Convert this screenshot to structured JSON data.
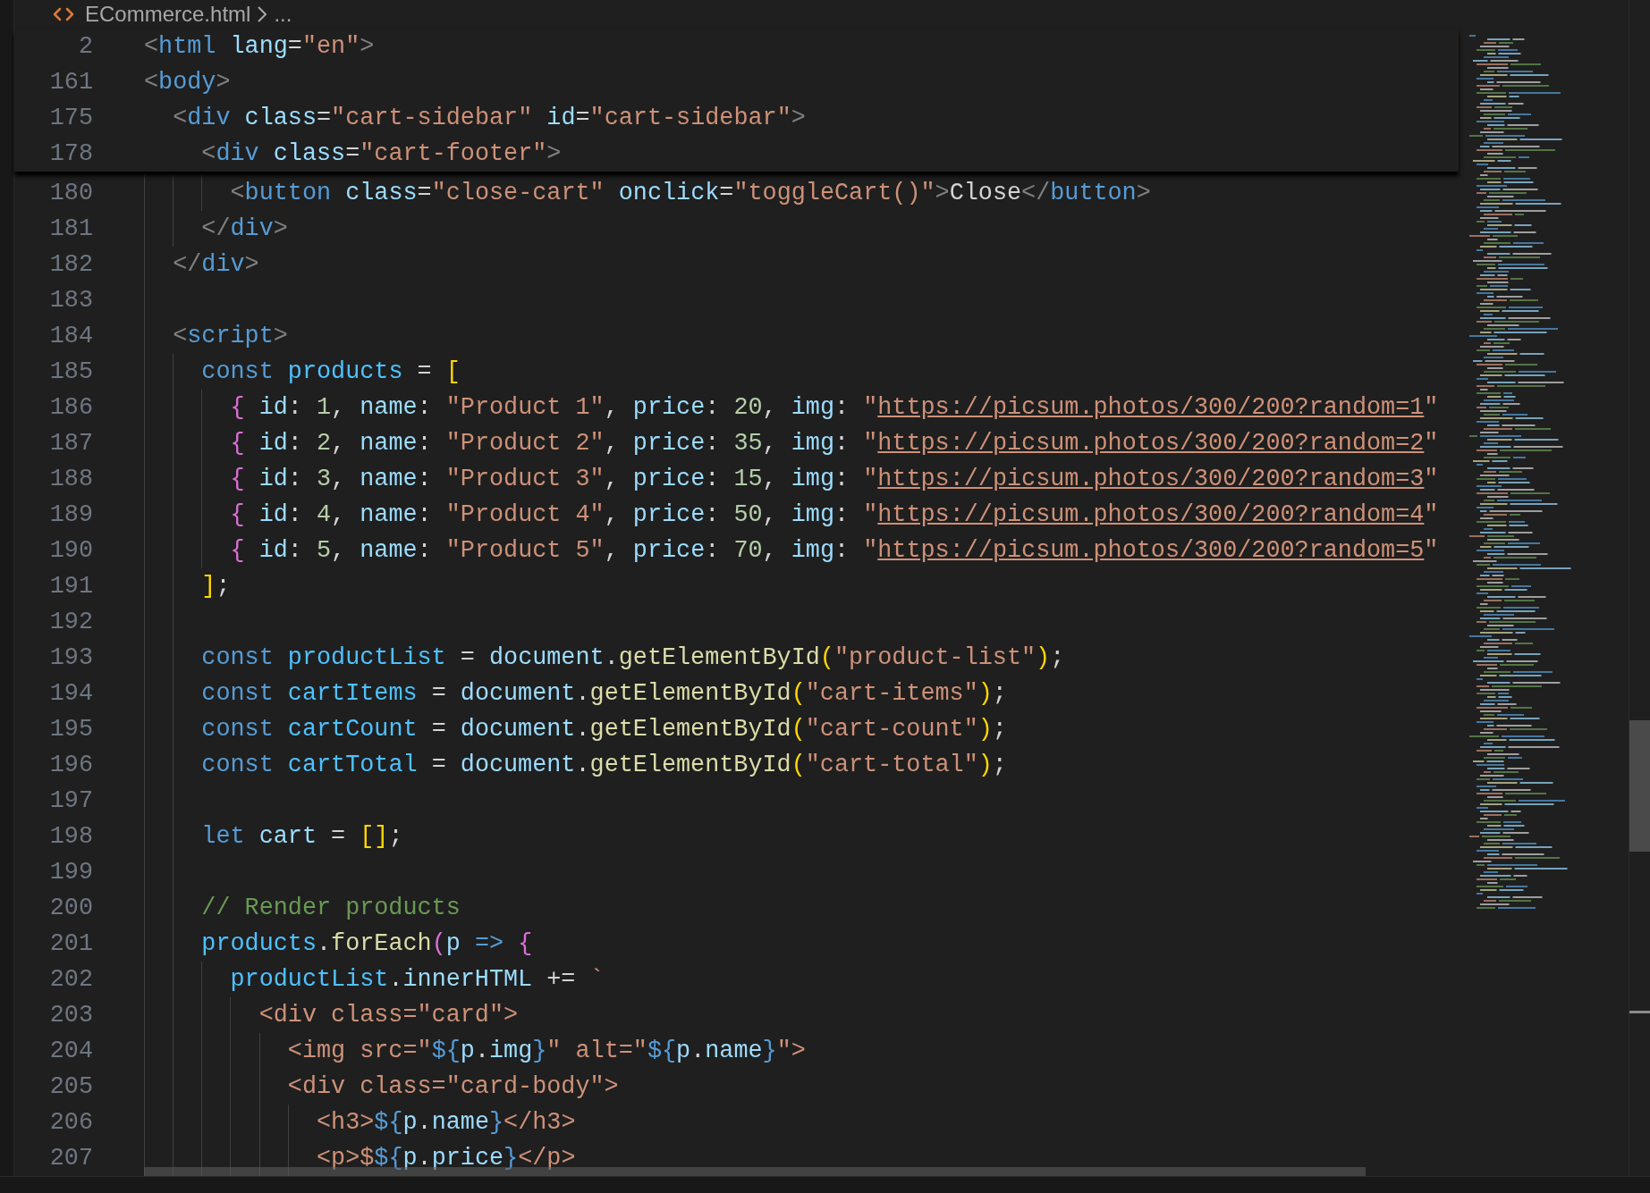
{
  "breadcrumb": {
    "file": "ECommerce.html",
    "rest": "..."
  },
  "sticky_scroll": [
    {
      "number": "2",
      "tokens": [
        {
          "kind": "punct",
          "text": "<"
        },
        {
          "kind": "tag",
          "text": "html"
        },
        {
          "kind": "attr",
          "text": " lang"
        },
        {
          "kind": "text",
          "text": "="
        },
        {
          "kind": "string",
          "text": "\"en\""
        },
        {
          "kind": "punct",
          "text": ">"
        }
      ]
    },
    {
      "number": "161",
      "tokens": [
        {
          "kind": "punct",
          "text": "<"
        },
        {
          "kind": "tag",
          "text": "body"
        },
        {
          "kind": "punct",
          "text": ">"
        }
      ]
    },
    {
      "number": "175",
      "tokens": [
        {
          "kind": "punct",
          "text": "  <"
        },
        {
          "kind": "tag",
          "text": "div"
        },
        {
          "kind": "attr",
          "text": " class"
        },
        {
          "kind": "text",
          "text": "="
        },
        {
          "kind": "string",
          "text": "\"cart-sidebar\""
        },
        {
          "kind": "attr",
          "text": " id"
        },
        {
          "kind": "text",
          "text": "="
        },
        {
          "kind": "string",
          "text": "\"cart-sidebar\""
        },
        {
          "kind": "punct",
          "text": ">"
        }
      ]
    },
    {
      "number": "178",
      "tokens": [
        {
          "kind": "punct",
          "text": "    <"
        },
        {
          "kind": "tag",
          "text": "div"
        },
        {
          "kind": "attr",
          "text": " class"
        },
        {
          "kind": "text",
          "text": "="
        },
        {
          "kind": "string",
          "text": "\"cart-footer\""
        },
        {
          "kind": "punct",
          "text": ">"
        }
      ]
    }
  ],
  "lines": [
    {
      "number": "180",
      "tokens": [
        {
          "kind": "punct",
          "text": "      <"
        },
        {
          "kind": "tag",
          "text": "button"
        },
        {
          "kind": "attr",
          "text": " class"
        },
        {
          "kind": "text",
          "text": "="
        },
        {
          "kind": "string",
          "text": "\"close-cart\""
        },
        {
          "kind": "attr",
          "text": " onclick"
        },
        {
          "kind": "text",
          "text": "="
        },
        {
          "kind": "string",
          "text": "\"toggleCart()\""
        },
        {
          "kind": "punct",
          "text": ">"
        },
        {
          "kind": "text",
          "text": "Close"
        },
        {
          "kind": "punct",
          "text": "</"
        },
        {
          "kind": "tag",
          "text": "button"
        },
        {
          "kind": "punct",
          "text": ">"
        }
      ]
    },
    {
      "number": "181",
      "tokens": [
        {
          "kind": "punct",
          "text": "    </"
        },
        {
          "kind": "tag",
          "text": "div"
        },
        {
          "kind": "punct",
          "text": ">"
        }
      ]
    },
    {
      "number": "182",
      "tokens": [
        {
          "kind": "punct",
          "text": "  </"
        },
        {
          "kind": "tag",
          "text": "div"
        },
        {
          "kind": "punct",
          "text": ">"
        }
      ]
    },
    {
      "number": "183"
    },
    {
      "number": "184",
      "tokens": [
        {
          "kind": "punct",
          "text": "  <"
        },
        {
          "kind": "tag",
          "text": "script"
        },
        {
          "kind": "punct",
          "text": ">"
        }
      ]
    },
    {
      "number": "185",
      "tokens": [
        {
          "kind": "keyword",
          "text": "    const"
        },
        {
          "kind": "const",
          "text": " products"
        },
        {
          "kind": "text",
          "text": " = "
        },
        {
          "kind": "bracket1",
          "text": "["
        }
      ]
    },
    {
      "number": "186",
      "tokens": [
        {
          "kind": "bracket2",
          "text": "      {"
        },
        {
          "kind": "var",
          "text": " id"
        },
        {
          "kind": "text",
          "text": ": "
        },
        {
          "kind": "number",
          "text": "1"
        },
        {
          "kind": "text",
          "text": ", "
        },
        {
          "kind": "var",
          "text": "name"
        },
        {
          "kind": "text",
          "text": ": "
        },
        {
          "kind": "string",
          "text": "\"Product 1\""
        },
        {
          "kind": "text",
          "text": ", "
        },
        {
          "kind": "var",
          "text": "price"
        },
        {
          "kind": "text",
          "text": ": "
        },
        {
          "kind": "number",
          "text": "20"
        },
        {
          "kind": "text",
          "text": ", "
        },
        {
          "kind": "var",
          "text": "img"
        },
        {
          "kind": "text",
          "text": ": "
        },
        {
          "kind": "string",
          "text": "\""
        },
        {
          "kind": "link",
          "text": "https://picsum.photos/300/200?random=1"
        },
        {
          "kind": "string",
          "text": "\""
        }
      ]
    },
    {
      "number": "187",
      "tokens": [
        {
          "kind": "bracket2",
          "text": "      {"
        },
        {
          "kind": "var",
          "text": " id"
        },
        {
          "kind": "text",
          "text": ": "
        },
        {
          "kind": "number",
          "text": "2"
        },
        {
          "kind": "text",
          "text": ", "
        },
        {
          "kind": "var",
          "text": "name"
        },
        {
          "kind": "text",
          "text": ": "
        },
        {
          "kind": "string",
          "text": "\"Product 2\""
        },
        {
          "kind": "text",
          "text": ", "
        },
        {
          "kind": "var",
          "text": "price"
        },
        {
          "kind": "text",
          "text": ": "
        },
        {
          "kind": "number",
          "text": "35"
        },
        {
          "kind": "text",
          "text": ", "
        },
        {
          "kind": "var",
          "text": "img"
        },
        {
          "kind": "text",
          "text": ": "
        },
        {
          "kind": "string",
          "text": "\""
        },
        {
          "kind": "link",
          "text": "https://picsum.photos/300/200?random=2"
        },
        {
          "kind": "string",
          "text": "\""
        }
      ]
    },
    {
      "number": "188",
      "tokens": [
        {
          "kind": "bracket2",
          "text": "      {"
        },
        {
          "kind": "var",
          "text": " id"
        },
        {
          "kind": "text",
          "text": ": "
        },
        {
          "kind": "number",
          "text": "3"
        },
        {
          "kind": "text",
          "text": ", "
        },
        {
          "kind": "var",
          "text": "name"
        },
        {
          "kind": "text",
          "text": ": "
        },
        {
          "kind": "string",
          "text": "\"Product 3\""
        },
        {
          "kind": "text",
          "text": ", "
        },
        {
          "kind": "var",
          "text": "price"
        },
        {
          "kind": "text",
          "text": ": "
        },
        {
          "kind": "number",
          "text": "15"
        },
        {
          "kind": "text",
          "text": ", "
        },
        {
          "kind": "var",
          "text": "img"
        },
        {
          "kind": "text",
          "text": ": "
        },
        {
          "kind": "string",
          "text": "\""
        },
        {
          "kind": "link",
          "text": "https://picsum.photos/300/200?random=3"
        },
        {
          "kind": "string",
          "text": "\""
        }
      ]
    },
    {
      "number": "189",
      "tokens": [
        {
          "kind": "bracket2",
          "text": "      {"
        },
        {
          "kind": "var",
          "text": " id"
        },
        {
          "kind": "text",
          "text": ": "
        },
        {
          "kind": "number",
          "text": "4"
        },
        {
          "kind": "text",
          "text": ", "
        },
        {
          "kind": "var",
          "text": "name"
        },
        {
          "kind": "text",
          "text": ": "
        },
        {
          "kind": "string",
          "text": "\"Product 4\""
        },
        {
          "kind": "text",
          "text": ", "
        },
        {
          "kind": "var",
          "text": "price"
        },
        {
          "kind": "text",
          "text": ": "
        },
        {
          "kind": "number",
          "text": "50"
        },
        {
          "kind": "text",
          "text": ", "
        },
        {
          "kind": "var",
          "text": "img"
        },
        {
          "kind": "text",
          "text": ": "
        },
        {
          "kind": "string",
          "text": "\""
        },
        {
          "kind": "link",
          "text": "https://picsum.photos/300/200?random=4"
        },
        {
          "kind": "string",
          "text": "\""
        }
      ]
    },
    {
      "number": "190",
      "tokens": [
        {
          "kind": "bracket2",
          "text": "      {"
        },
        {
          "kind": "var",
          "text": " id"
        },
        {
          "kind": "text",
          "text": ": "
        },
        {
          "kind": "number",
          "text": "5"
        },
        {
          "kind": "text",
          "text": ", "
        },
        {
          "kind": "var",
          "text": "name"
        },
        {
          "kind": "text",
          "text": ": "
        },
        {
          "kind": "string",
          "text": "\"Product 5\""
        },
        {
          "kind": "text",
          "text": ", "
        },
        {
          "kind": "var",
          "text": "price"
        },
        {
          "kind": "text",
          "text": ": "
        },
        {
          "kind": "number",
          "text": "70"
        },
        {
          "kind": "text",
          "text": ", "
        },
        {
          "kind": "var",
          "text": "img"
        },
        {
          "kind": "text",
          "text": ": "
        },
        {
          "kind": "string",
          "text": "\""
        },
        {
          "kind": "link",
          "text": "https://picsum.photos/300/200?random=5"
        },
        {
          "kind": "string",
          "text": "\""
        }
      ]
    },
    {
      "number": "191",
      "tokens": [
        {
          "kind": "bracket1",
          "text": "    ]"
        },
        {
          "kind": "text",
          "text": ";"
        }
      ]
    },
    {
      "number": "192"
    },
    {
      "number": "193",
      "tokens": [
        {
          "kind": "keyword",
          "text": "    const"
        },
        {
          "kind": "const",
          "text": " productList"
        },
        {
          "kind": "text",
          "text": " = "
        },
        {
          "kind": "var",
          "text": "document"
        },
        {
          "kind": "text",
          "text": "."
        },
        {
          "kind": "func",
          "text": "getElementById"
        },
        {
          "kind": "bracket1",
          "text": "("
        },
        {
          "kind": "string",
          "text": "\"product-list\""
        },
        {
          "kind": "bracket1",
          "text": ")"
        },
        {
          "kind": "text",
          "text": ";"
        }
      ]
    },
    {
      "number": "194",
      "tokens": [
        {
          "kind": "keyword",
          "text": "    const"
        },
        {
          "kind": "const",
          "text": " cartItems"
        },
        {
          "kind": "text",
          "text": " = "
        },
        {
          "kind": "var",
          "text": "document"
        },
        {
          "kind": "text",
          "text": "."
        },
        {
          "kind": "func",
          "text": "getElementById"
        },
        {
          "kind": "bracket1",
          "text": "("
        },
        {
          "kind": "string",
          "text": "\"cart-items\""
        },
        {
          "kind": "bracket1",
          "text": ")"
        },
        {
          "kind": "text",
          "text": ";"
        }
      ]
    },
    {
      "number": "195",
      "tokens": [
        {
          "kind": "keyword",
          "text": "    const"
        },
        {
          "kind": "const",
          "text": " cartCount"
        },
        {
          "kind": "text",
          "text": " = "
        },
        {
          "kind": "var",
          "text": "document"
        },
        {
          "kind": "text",
          "text": "."
        },
        {
          "kind": "func",
          "text": "getElementById"
        },
        {
          "kind": "bracket1",
          "text": "("
        },
        {
          "kind": "string",
          "text": "\"cart-count\""
        },
        {
          "kind": "bracket1",
          "text": ")"
        },
        {
          "kind": "text",
          "text": ";"
        }
      ]
    },
    {
      "number": "196",
      "tokens": [
        {
          "kind": "keyword",
          "text": "    const"
        },
        {
          "kind": "const",
          "text": " cartTotal"
        },
        {
          "kind": "text",
          "text": " = "
        },
        {
          "kind": "var",
          "text": "document"
        },
        {
          "kind": "text",
          "text": "."
        },
        {
          "kind": "func",
          "text": "getElementById"
        },
        {
          "kind": "bracket1",
          "text": "("
        },
        {
          "kind": "string",
          "text": "\"cart-total\""
        },
        {
          "kind": "bracket1",
          "text": ")"
        },
        {
          "kind": "text",
          "text": ";"
        }
      ]
    },
    {
      "number": "197"
    },
    {
      "number": "198",
      "tokens": [
        {
          "kind": "keyword",
          "text": "    let"
        },
        {
          "kind": "var",
          "text": " cart"
        },
        {
          "kind": "text",
          "text": " = "
        },
        {
          "kind": "bracket1",
          "text": "[]"
        },
        {
          "kind": "text",
          "text": ";"
        }
      ]
    },
    {
      "number": "199"
    },
    {
      "number": "200",
      "tokens": [
        {
          "kind": "comment",
          "text": "    // Render products"
        }
      ]
    },
    {
      "number": "201",
      "tokens": [
        {
          "kind": "const",
          "text": "    products"
        },
        {
          "kind": "text",
          "text": "."
        },
        {
          "kind": "func",
          "text": "forEach"
        },
        {
          "kind": "bracket2",
          "text": "("
        },
        {
          "kind": "var",
          "text": "p"
        },
        {
          "kind": "keyword",
          "text": " =>"
        },
        {
          "kind": "bracket2",
          "text": " {"
        }
      ]
    },
    {
      "number": "202",
      "tokens": [
        {
          "kind": "const",
          "text": "      productList"
        },
        {
          "kind": "text",
          "text": "."
        },
        {
          "kind": "var",
          "text": "innerHTML"
        },
        {
          "kind": "text",
          "text": " += "
        },
        {
          "kind": "string",
          "text": "`"
        }
      ]
    },
    {
      "number": "203",
      "tokens": [
        {
          "kind": "string",
          "text": "        <div class=\"card\">"
        }
      ]
    },
    {
      "number": "204",
      "tokens": [
        {
          "kind": "string",
          "text": "          <img src=\""
        },
        {
          "kind": "keyword",
          "text": "${"
        },
        {
          "kind": "var",
          "text": "p"
        },
        {
          "kind": "text",
          "text": "."
        },
        {
          "kind": "var",
          "text": "img"
        },
        {
          "kind": "keyword",
          "text": "}"
        },
        {
          "kind": "string",
          "text": "\" alt=\""
        },
        {
          "kind": "keyword",
          "text": "${"
        },
        {
          "kind": "var",
          "text": "p"
        },
        {
          "kind": "text",
          "text": "."
        },
        {
          "kind": "var",
          "text": "name"
        },
        {
          "kind": "keyword",
          "text": "}"
        },
        {
          "kind": "string",
          "text": "\">"
        }
      ]
    },
    {
      "number": "205",
      "tokens": [
        {
          "kind": "string",
          "text": "          <div class=\"card-body\">"
        }
      ]
    },
    {
      "number": "206",
      "tokens": [
        {
          "kind": "string",
          "text": "            <h3>"
        },
        {
          "kind": "keyword",
          "text": "${"
        },
        {
          "kind": "var",
          "text": "p"
        },
        {
          "kind": "text",
          "text": "."
        },
        {
          "kind": "var",
          "text": "name"
        },
        {
          "kind": "keyword",
          "text": "}"
        },
        {
          "kind": "string",
          "text": "</h3>"
        }
      ]
    },
    {
      "number": "207",
      "tokens": [
        {
          "kind": "string",
          "text": "            <p>$"
        },
        {
          "kind": "keyword",
          "text": "${"
        },
        {
          "kind": "var",
          "text": "p"
        },
        {
          "kind": "text",
          "text": "."
        },
        {
          "kind": "var",
          "text": "price"
        },
        {
          "kind": "keyword",
          "text": "}"
        },
        {
          "kind": "string",
          "text": "</p>"
        }
      ]
    }
  ]
}
